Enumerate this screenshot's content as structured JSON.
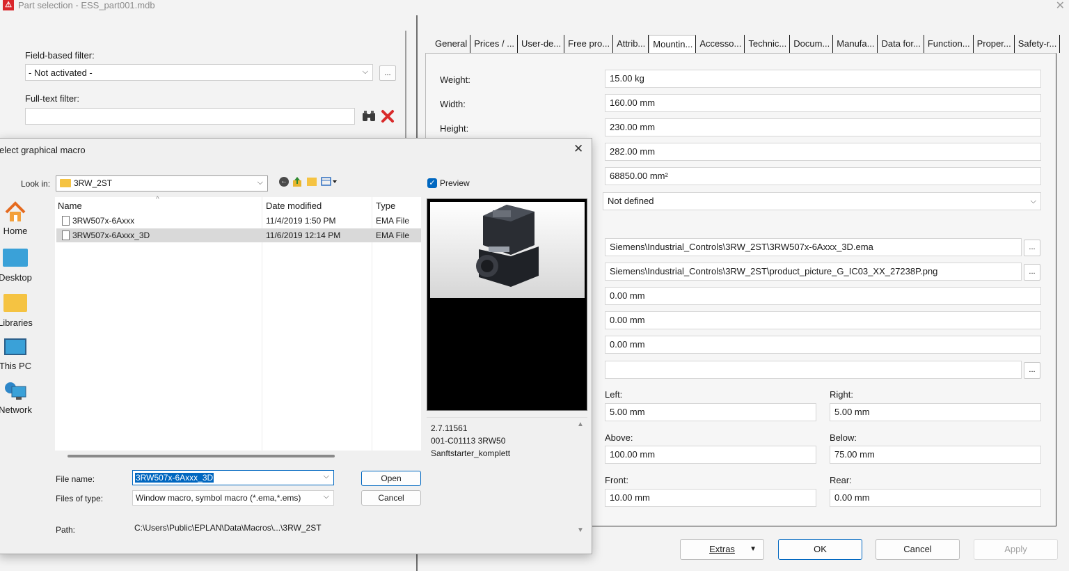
{
  "window": {
    "title": "Part selection - ESS_part001.mdb",
    "close_glyph": "✕"
  },
  "left": {
    "field_filter_label": "Field-based filter:",
    "field_filter_value": "- Not activated -",
    "full_text_label": "Full-text filter:",
    "full_text_value": "",
    "more_btn": "..."
  },
  "tabs": [
    "General",
    "Prices / ...",
    "User-de...",
    "Free pro...",
    "Attrib...",
    "Mountin...",
    "Accesso...",
    "Technic...",
    "Docum...",
    "Manufa...",
    "Data for...",
    "Function...",
    "Proper...",
    "Safety-r..."
  ],
  "active_tab": "Mountin...",
  "props": {
    "weight_label": "Weight:",
    "width_label": "Width:",
    "height_label": "Height:",
    "weight": "15.00 kg",
    "width": "160.00 mm",
    "height": "230.00 mm",
    "depth": "282.00 mm",
    "area": "68850.00 mm²",
    "mounting_select": "Not defined",
    "macro_path": "Siemens\\Industrial_Controls\\3RW_2ST\\3RW507x-6Axxx_3D.ema",
    "picture_path": "Siemens\\Industrial_Controls\\3RW_2ST\\product_picture_G_IC03_XX_27238P.png",
    "offset1": "0.00 mm",
    "offset2": "0.00 mm",
    "offset3": "0.00 mm",
    "empty_field": "",
    "left_label": "Left:",
    "left": "5.00 mm",
    "right_label": "Right:",
    "right": "5.00 mm",
    "above_label": "Above:",
    "above": "100.00 mm",
    "below_label": "Below:",
    "below": "75.00 mm",
    "front_label": "Front:",
    "front": "10.00 mm",
    "rear_label": "Rear:",
    "rear": "0.00 mm",
    "dots": "..."
  },
  "buttons": {
    "extras": "Extras",
    "ok": "OK",
    "cancel": "Cancel",
    "apply": "Apply"
  },
  "dialog": {
    "title": "elect graphical macro",
    "close_glyph": "✕",
    "look_in_label": "Look in:",
    "look_in_value": "3RW_2ST",
    "preview_label": "Preview",
    "preview_checked": true,
    "nav": [
      "Home",
      "Desktop",
      "Libraries",
      "This PC",
      "Network"
    ],
    "columns": {
      "name": "Name",
      "date": "Date modified",
      "type": "Type"
    },
    "files": [
      {
        "name": "3RW507x-6Axxx",
        "date": "11/4/2019 1:50 PM",
        "type": "EMA File",
        "selected": false
      },
      {
        "name": "3RW507x-6Axxx_3D",
        "date": "11/6/2019 12:14 PM",
        "type": "EMA File",
        "selected": true
      }
    ],
    "file_name_label": "File name:",
    "file_name_value": "3RW507x-6Axxx_3D",
    "files_of_type_label": "Files of type:",
    "files_of_type_value": "Window macro, symbol macro (*.ema,*.ems)",
    "path_label": "Path:",
    "path_value": "C:\\Users\\Public\\EPLAN\\Data\\Macros\\...\\3RW_2ST",
    "open_btn": "Open",
    "cancel_btn": "Cancel",
    "desc_line1": "2.7.11561",
    "desc_line2": "001-C01113 3RW50",
    "desc_line3": "Sanftstarter_komplett"
  },
  "colors": {
    "accent": "#0067c0",
    "selection": "#cce8ff",
    "delete_red": "#d92b2b"
  }
}
